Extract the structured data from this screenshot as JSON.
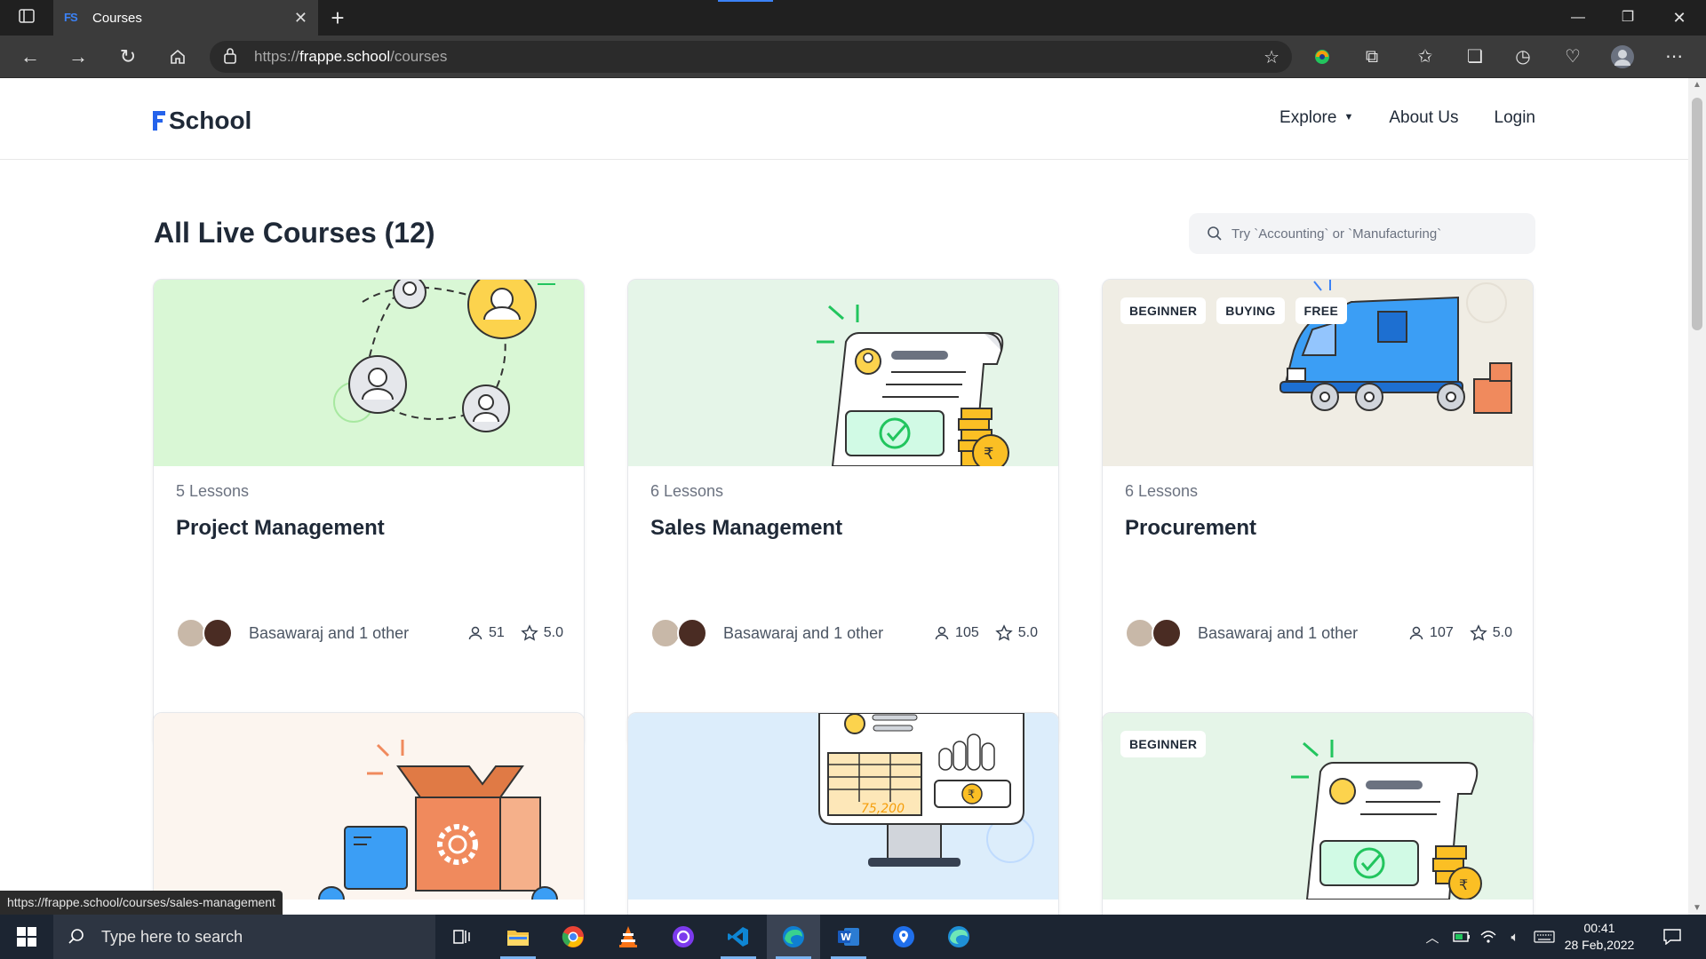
{
  "browser": {
    "tab_title": "Courses",
    "tab_favicon": "FS",
    "url_scheme": "https://",
    "url_host": "frappe.school",
    "url_path": "/courses",
    "status_url": "https://frappe.school/courses/sales-management"
  },
  "site": {
    "logo_text": "School",
    "nav": {
      "explore": "Explore",
      "about": "About Us",
      "login": "Login"
    }
  },
  "main": {
    "heading": "All Live Courses (12)",
    "search_placeholder": "Try `Accounting` or `Manufacturing`"
  },
  "courses": [
    {
      "lessons": "5 Lessons",
      "title": "Project Management",
      "authors": "Basawaraj and 1 other",
      "students": "51",
      "rating": "5.0",
      "tags": [],
      "banner_color": "#d9f7d5"
    },
    {
      "lessons": "6 Lessons",
      "title": "Sales Management",
      "authors": "Basawaraj and 1 other",
      "students": "105",
      "rating": "5.0",
      "tags": [],
      "banner_color": "#e5f5e8"
    },
    {
      "lessons": "6 Lessons",
      "title": "Procurement",
      "authors": "Basawaraj and 1 other",
      "students": "107",
      "rating": "5.0",
      "tags": [
        "BEGINNER",
        "BUYING",
        "FREE"
      ],
      "banner_color": "#f0ede4"
    },
    {
      "banner_color": "#fcf5ef",
      "tags": []
    },
    {
      "banner_color": "#dcedfb",
      "tags": [],
      "amount": "75,200"
    },
    {
      "banner_color": "#e5f5e8",
      "tags": [
        "BEGINNER"
      ]
    }
  ],
  "taskbar": {
    "search_placeholder": "Type here to search",
    "time": "00:41",
    "date": "28 Feb,2022"
  },
  "colors": {
    "accent": "#2563eb",
    "text_primary": "#1f2937",
    "text_secondary": "#6b7280"
  }
}
